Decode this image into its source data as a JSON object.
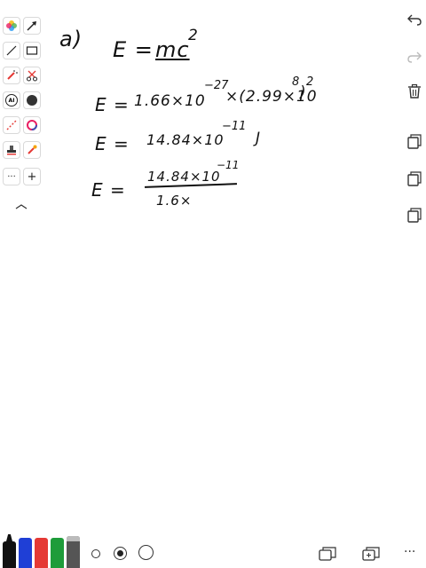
{
  "toolbar_left": {
    "items": [
      {
        "name": "color-wheel-icon"
      },
      {
        "name": "arrow-tool-icon"
      },
      {
        "name": "line-tool-icon"
      },
      {
        "name": "rectangle-tool-icon"
      },
      {
        "name": "magic-wand-icon"
      },
      {
        "name": "scissors-icon"
      },
      {
        "name": "ai-icon",
        "label": "AI"
      },
      {
        "name": "fill-circle-icon"
      },
      {
        "name": "dotted-line-icon"
      },
      {
        "name": "color-ring-icon"
      },
      {
        "name": "stamp-icon"
      },
      {
        "name": "dropper-icon"
      },
      {
        "name": "more-icon",
        "label": "···"
      },
      {
        "name": "add-icon",
        "label": "+"
      },
      {
        "name": "collapse-chevron-icon"
      }
    ]
  },
  "toolbar_right": [
    "undo-icon",
    "redo-icon",
    "trash-icon",
    "copy-page-icon",
    "copy-page-icon",
    "copy-page-icon"
  ],
  "handwriting": {
    "label": "a)",
    "eq1_lhs": "E =",
    "eq1_rhs": "mc",
    "eq1_exp": "2",
    "eq2_lhs": "E =",
    "eq2_rhs": "1.66×10",
    "eq2_exp": "−27",
    "eq2_rest": "×(2.99×10",
    "eq2_exp2": "8",
    "eq2_close": ")",
    "eq2_exp3": "2",
    "eq3_lhs": "E =",
    "eq3_rhs": "14.84×10",
    "eq3_exp": "−11",
    "eq3_unit": "J",
    "eq4_lhs": "E =",
    "eq4_num": "14.84×10",
    "eq4_num_exp": "−11",
    "eq4_den": "1.6×"
  },
  "bottom_bar": {
    "markers": [
      "#111111",
      "#1f3fd6",
      "#e53935",
      "#1e9c3a",
      "#555555"
    ],
    "sizes": [
      "small",
      "medium",
      "large"
    ],
    "more_label": "···"
  },
  "colors": {
    "ink": "#111111",
    "toolbar_border": "#d9d9d9",
    "accent_red": "#e53935"
  }
}
